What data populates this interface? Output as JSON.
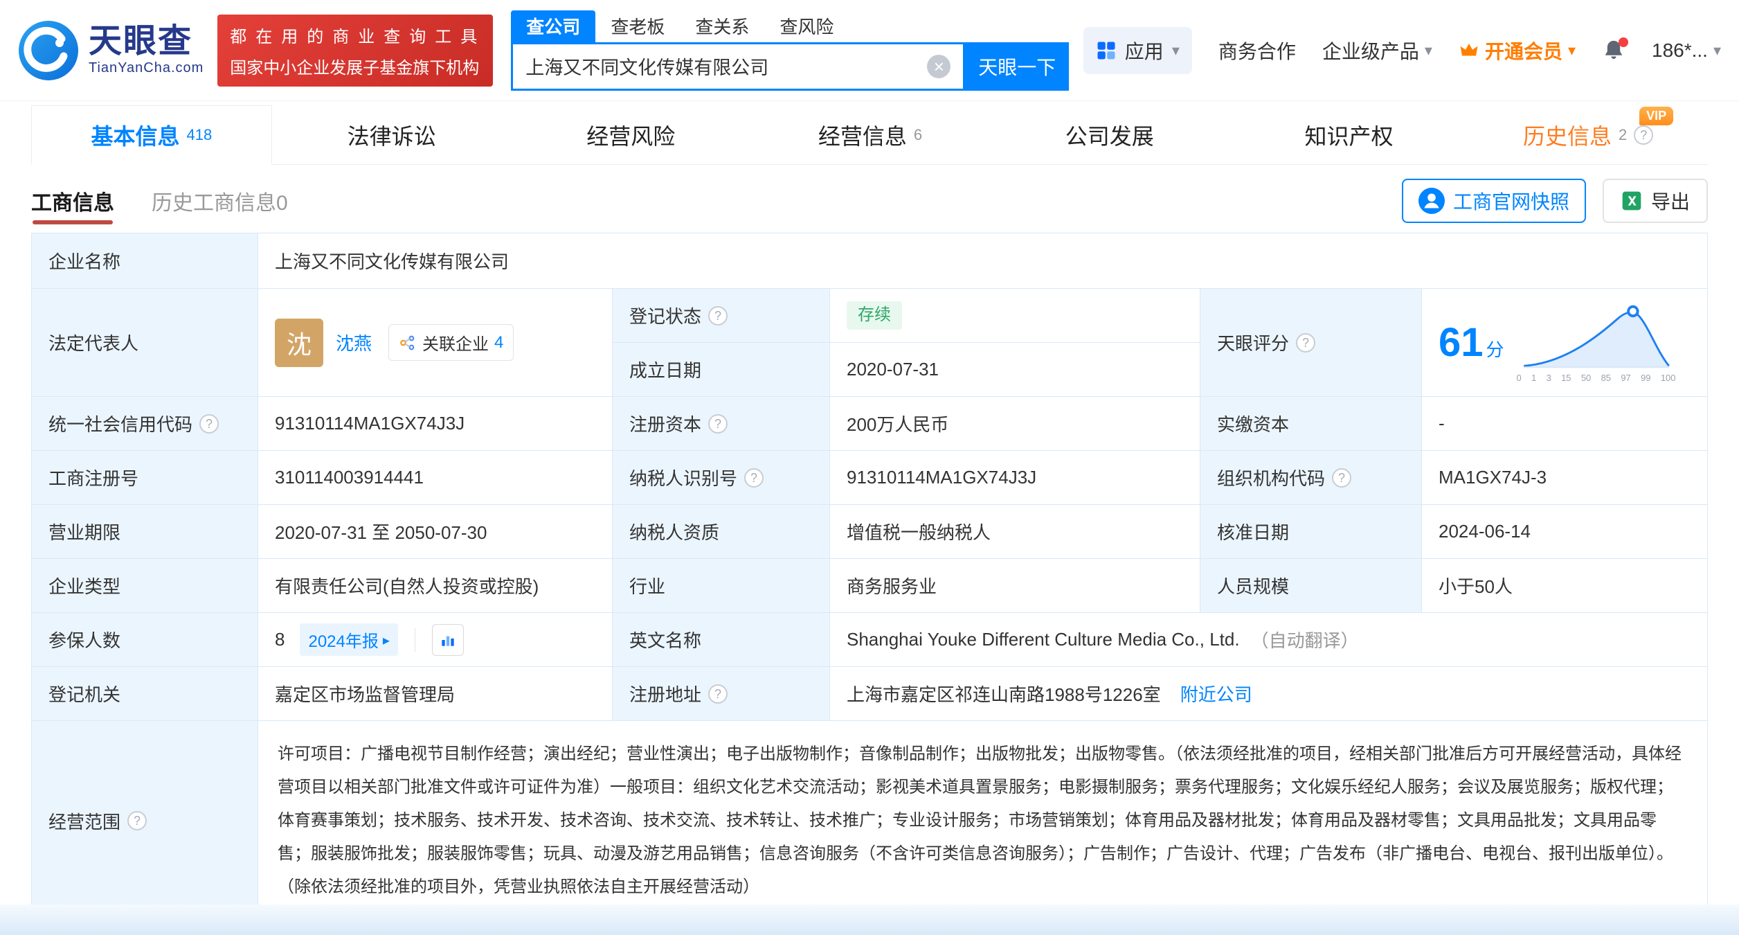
{
  "brand": {
    "name": "天眼查",
    "domain": "TianYanCha.com"
  },
  "banner": {
    "line1": "都在用的商业查询工具",
    "line2": "国家中小企业发展子基金旗下机构"
  },
  "search": {
    "tabs": [
      "查公司",
      "查老板",
      "查关系",
      "查风险"
    ],
    "value": "上海又不同文化传媒有限公司",
    "button": "天眼一下"
  },
  "topnav": {
    "apps": "应用",
    "cooperation": "商务合作",
    "enterprise": "企业级产品",
    "vip": "开通会员",
    "phone": "186*..."
  },
  "tabs": [
    {
      "label": "基本信息",
      "count": "418"
    },
    {
      "label": "法律诉讼",
      "count": ""
    },
    {
      "label": "经营风险",
      "count": ""
    },
    {
      "label": "经营信息",
      "count": "6"
    },
    {
      "label": "公司发展",
      "count": ""
    },
    {
      "label": "知识产权",
      "count": ""
    },
    {
      "label": "历史信息",
      "count": "2",
      "vip": "VIP"
    }
  ],
  "subtabs": {
    "active": "工商信息",
    "inactive": "历史工商信息0"
  },
  "toolbar": {
    "snapshot": "工商官网快照",
    "export": "导出"
  },
  "fields": {
    "company_name": {
      "label": "企业名称",
      "value": "上海又不同文化传媒有限公司"
    },
    "legal_rep": {
      "label": "法定代表人",
      "avatar": "沈",
      "name": "沈燕",
      "related": "关联企业",
      "related_count": "4"
    },
    "reg_status": {
      "label": "登记状态",
      "value": "存续"
    },
    "establish_date": {
      "label": "成立日期",
      "value": "2020-07-31"
    },
    "score": {
      "label": "天眼评分",
      "value": "61",
      "unit": "分",
      "axis": [
        "0",
        "1",
        "3",
        "15",
        "50",
        "85",
        "97",
        "99",
        "100"
      ]
    },
    "credit_code": {
      "label": "统一社会信用代码",
      "value": "91310114MA1GX74J3J"
    },
    "reg_capital": {
      "label": "注册资本",
      "value": "200万人民币"
    },
    "paid_capital": {
      "label": "实缴资本",
      "value": "-"
    },
    "reg_number": {
      "label": "工商注册号",
      "value": "310114003914441"
    },
    "taxpayer_id": {
      "label": "纳税人识别号",
      "value": "91310114MA1GX74J3J"
    },
    "org_code": {
      "label": "组织机构代码",
      "value": "MA1GX74J-3"
    },
    "business_term": {
      "label": "营业期限",
      "value": "2020-07-31 至 2050-07-30"
    },
    "taxpayer_quality": {
      "label": "纳税人资质",
      "value": "增值税一般纳税人"
    },
    "approval_date": {
      "label": "核准日期",
      "value": "2024-06-14"
    },
    "company_type": {
      "label": "企业类型",
      "value": "有限责任公司(自然人投资或控股)"
    },
    "industry": {
      "label": "行业",
      "value": "商务服务业"
    },
    "staff_size": {
      "label": "人员规模",
      "value": "小于50人"
    },
    "insured": {
      "label": "参保人数",
      "value": "8",
      "report": "2024年报"
    },
    "english_name": {
      "label": "英文名称",
      "value": "Shanghai Youke Different Culture Media Co., Ltd.",
      "note": "（自动翻译）"
    },
    "reg_authority": {
      "label": "登记机关",
      "value": "嘉定区市场监督管理局"
    },
    "address": {
      "label": "注册地址",
      "value": "上海市嘉定区祁连山南路1988号1226室",
      "link": "附近公司"
    },
    "business_scope": {
      "label": "经营范围",
      "value": "许可项目：广播电视节目制作经营；演出经纪；营业性演出；电子出版物制作；音像制品制作；出版物批发；出版物零售。（依法须经批准的项目，经相关部门批准后方可开展经营活动，具体经营项目以相关部门批准文件或许可证件为准）一般项目：组织文化艺术交流活动；影视美术道具置景服务；电影摄制服务；票务代理服务；文化娱乐经纪人服务；会议及展览服务；版权代理；体育赛事策划；技术服务、技术开发、技术咨询、技术交流、技术转让、技术推广；专业设计服务；市场营销策划；体育用品及器材批发；体育用品及器材零售；文具用品批发；文具用品零售；服装服饰批发；服装服饰零售；玩具、动漫及游艺用品销售；信息咨询服务（不含许可类信息咨询服务）；广告制作；广告设计、代理；广告发布（非广播电台、电视台、报刊出版单位）。（除依法须经批准的项目外，凭营业执照依法自主开展经营活动）"
    }
  },
  "colors": {
    "accent": "#0084FF",
    "vip_orange": "#FF8000",
    "status_green": "#2DA769",
    "banner_red": "#DB3831"
  }
}
